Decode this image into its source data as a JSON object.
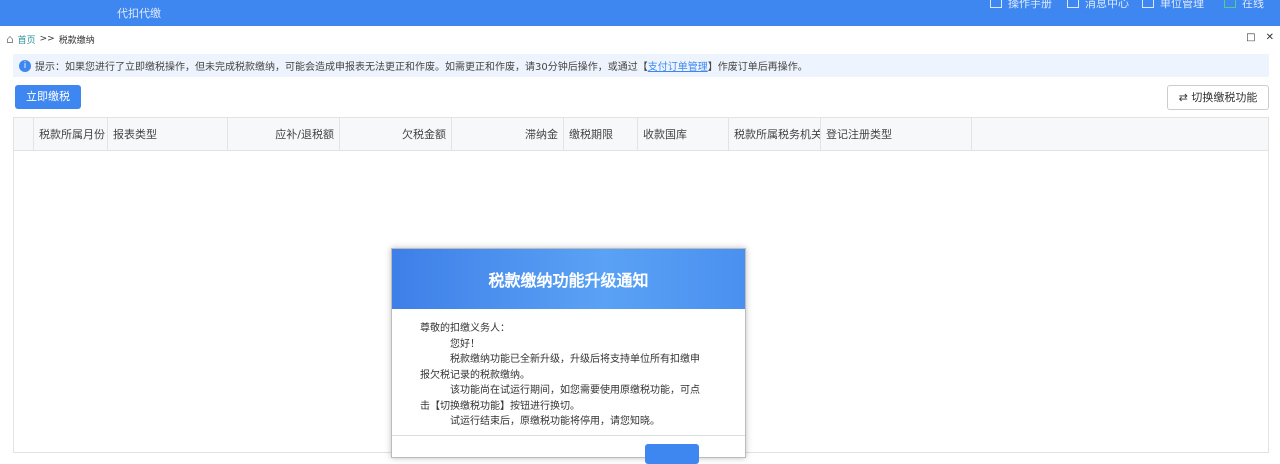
{
  "header": {
    "title": "代扣代缴",
    "nav": [
      {
        "label": "操作手册",
        "icon": "manual-icon"
      },
      {
        "label": "消息中心",
        "icon": "message-icon"
      },
      {
        "label": "单位管理",
        "icon": "unit-icon"
      },
      {
        "label": "在线",
        "icon": "online-icon"
      }
    ]
  },
  "breadcrumb": {
    "home": "首页",
    "sep": ">>",
    "current": "税款缴纳"
  },
  "tip": {
    "icon": "i",
    "prefix": "提示：如果您进行了立即缴税操作，但未完成税款缴纳，可能会造成申报表无法更正和作废。如需更正和作废，请30分钟后操作，或通过【",
    "link": "支付订单管理",
    "suffix": "】作废订单后再操作。"
  },
  "toolbar": {
    "pay_now": "立即缴税",
    "switch": "⇄ 切换缴税功能"
  },
  "table": {
    "columns": [
      "税款所属月份",
      "报表类型",
      "应补/退税额",
      "欠税金额",
      "滞纳金",
      "缴税期限",
      "收款国库",
      "税款所属税务机关",
      "登记注册类型"
    ]
  },
  "modal": {
    "title": "税款缴纳功能升级通知",
    "greeting": "尊敬的扣缴义务人：",
    "lines": [
      "您好！",
      "税款缴纳功能已全新升级，升级后将支持单位所有扣缴申报欠税记录的税款缴纳。",
      "该功能尚在试运行期间，如您需要使用原缴税功能，可点击【切换缴税功能】按钮进行换切。",
      "试运行结束后，原缴税功能将停用，请您知晓。"
    ]
  }
}
